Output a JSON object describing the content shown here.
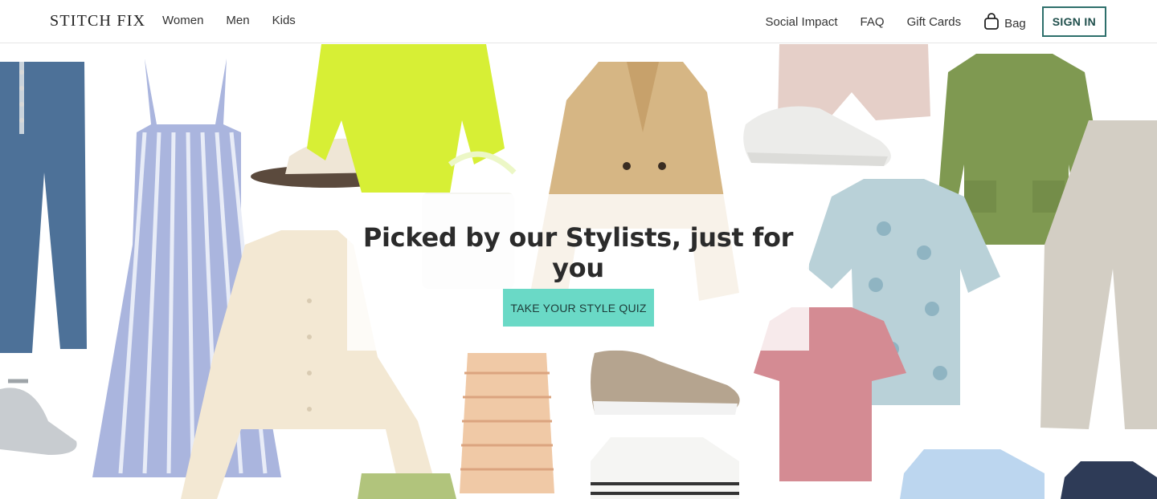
{
  "header": {
    "logo": "STITCH FIX",
    "nav_left": [
      "Women",
      "Men",
      "Kids"
    ],
    "nav_right": [
      "Social Impact",
      "FAQ",
      "Gift Cards"
    ],
    "bag_label": "Bag",
    "bag_icon": "shopping-bag-icon",
    "signin_label": "SIGN IN"
  },
  "hero": {
    "headline": "Picked by our Stylists, just for you",
    "cta_label": "TAKE YOUR STYLE QUIZ",
    "colors": {
      "cta_background": "#6ad9c6",
      "signin_border": "#2d6f6b"
    }
  }
}
